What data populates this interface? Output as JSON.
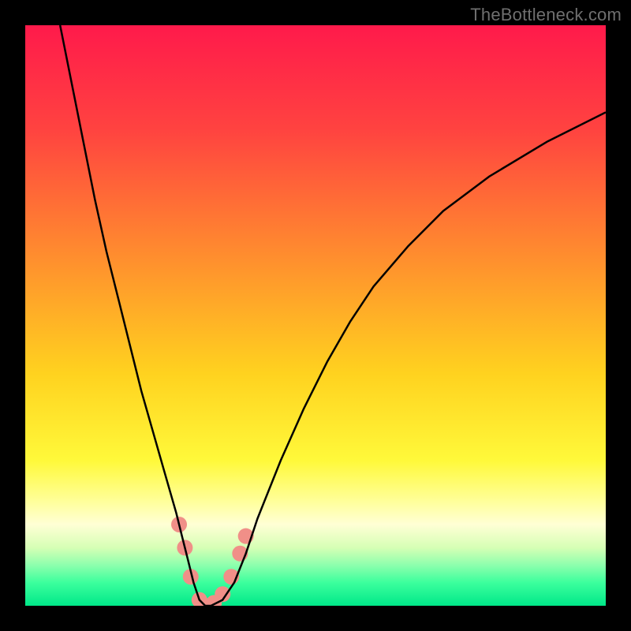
{
  "watermark": "TheBottleneck.com",
  "chart_data": {
    "type": "line",
    "title": "",
    "xlabel": "",
    "ylabel": "",
    "xlim": [
      0,
      100
    ],
    "ylim": [
      0,
      100
    ],
    "grid": false,
    "legend": false,
    "background_gradient": {
      "stops": [
        {
          "offset": 0.0,
          "color": "#ff1a4b"
        },
        {
          "offset": 0.18,
          "color": "#ff4340"
        },
        {
          "offset": 0.4,
          "color": "#ff8e2e"
        },
        {
          "offset": 0.6,
          "color": "#ffd21f"
        },
        {
          "offset": 0.75,
          "color": "#fff93a"
        },
        {
          "offset": 0.82,
          "color": "#ffff9a"
        },
        {
          "offset": 0.86,
          "color": "#ffffd5"
        },
        {
          "offset": 0.9,
          "color": "#d6ffb5"
        },
        {
          "offset": 0.93,
          "color": "#8dffad"
        },
        {
          "offset": 0.96,
          "color": "#3cff9d"
        },
        {
          "offset": 1.0,
          "color": "#00e889"
        }
      ]
    },
    "series": [
      {
        "name": "bottleneck-curve",
        "color": "#000000",
        "x": [
          6,
          8,
          10,
          12,
          14,
          16,
          18,
          20,
          22,
          24,
          26,
          27,
          28,
          29,
          30,
          31,
          32,
          34,
          36,
          38,
          40,
          44,
          48,
          52,
          56,
          60,
          66,
          72,
          80,
          90,
          100
        ],
        "y": [
          100,
          90,
          80,
          70,
          61,
          53,
          45,
          37,
          30,
          23,
          16,
          12,
          8,
          4,
          1,
          0,
          0,
          1,
          4,
          9,
          15,
          25,
          34,
          42,
          49,
          55,
          62,
          68,
          74,
          80,
          85
        ]
      }
    ],
    "markers": {
      "name": "highlight-dots",
      "color": "#f08f88",
      "radius_px": 10,
      "points": [
        {
          "x": 26.5,
          "y": 14
        },
        {
          "x": 27.5,
          "y": 10
        },
        {
          "x": 28.5,
          "y": 5
        },
        {
          "x": 30.0,
          "y": 1
        },
        {
          "x": 31.0,
          "y": 0
        },
        {
          "x": 32.5,
          "y": 0.5
        },
        {
          "x": 34.0,
          "y": 2
        },
        {
          "x": 35.5,
          "y": 5
        },
        {
          "x": 37.0,
          "y": 9
        },
        {
          "x": 38.0,
          "y": 12
        }
      ]
    }
  }
}
